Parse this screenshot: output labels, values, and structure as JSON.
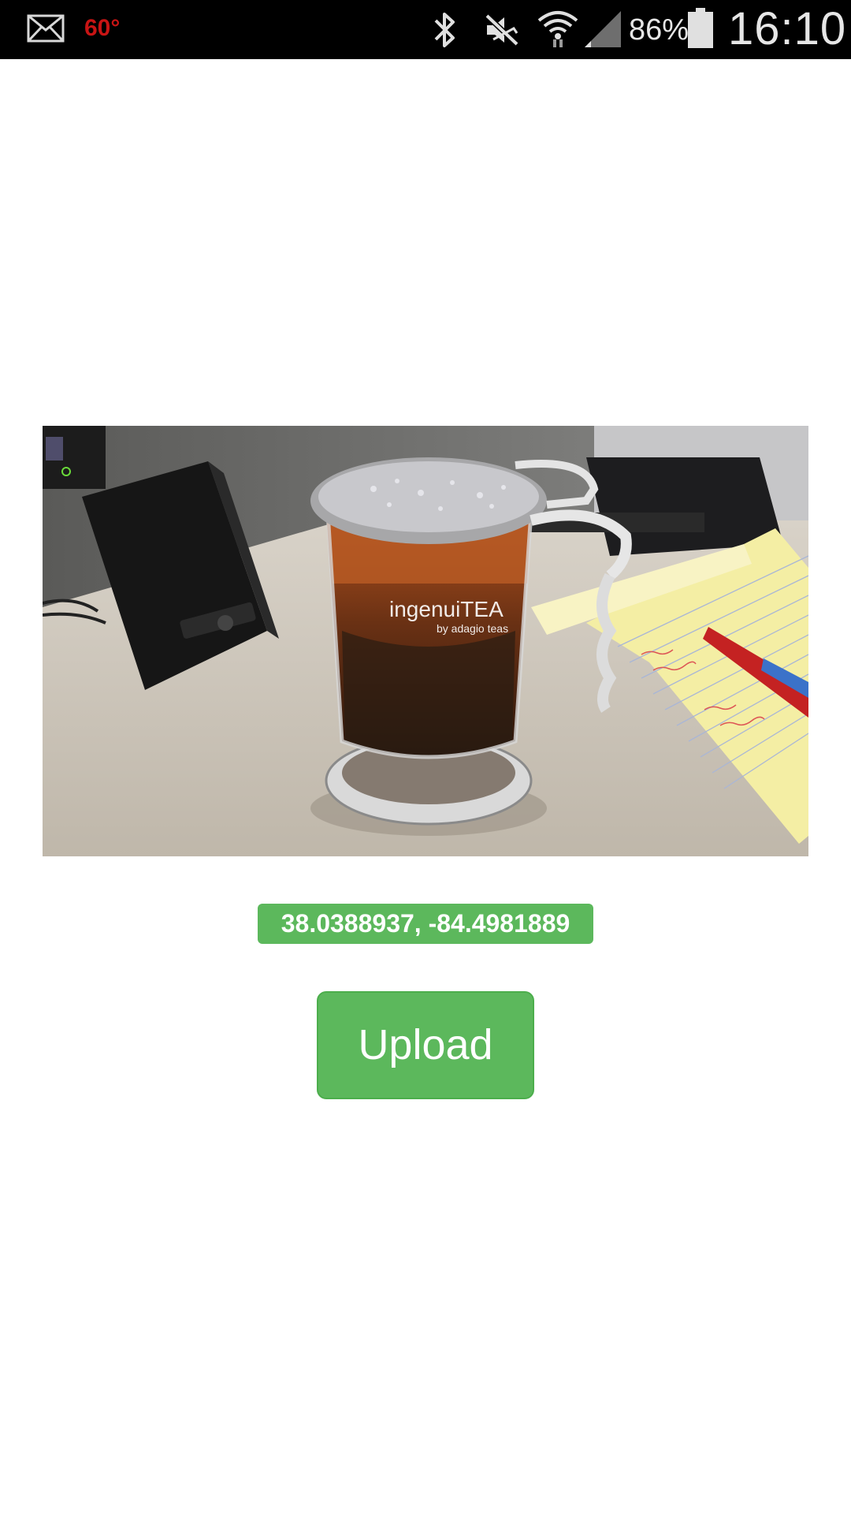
{
  "status_bar": {
    "notification_icon": "mail-icon",
    "temperature": "60°",
    "icons": [
      "bluetooth-icon",
      "mute-icon",
      "wifi-icon",
      "signal-icon",
      "battery-icon"
    ],
    "battery_percent": "86%",
    "time": "16:10"
  },
  "photo": {
    "alt": "",
    "product_text": "ingenuiTEA",
    "product_subtext": "by adagio teas"
  },
  "location": {
    "coordinates": "38.0388937, -84.4981889"
  },
  "actions": {
    "upload_label": "Upload"
  },
  "colors": {
    "accent": "#5cb85c",
    "accent_border": "#4cae4c",
    "status_bar_bg": "#000000",
    "temperature": "#c81414"
  }
}
